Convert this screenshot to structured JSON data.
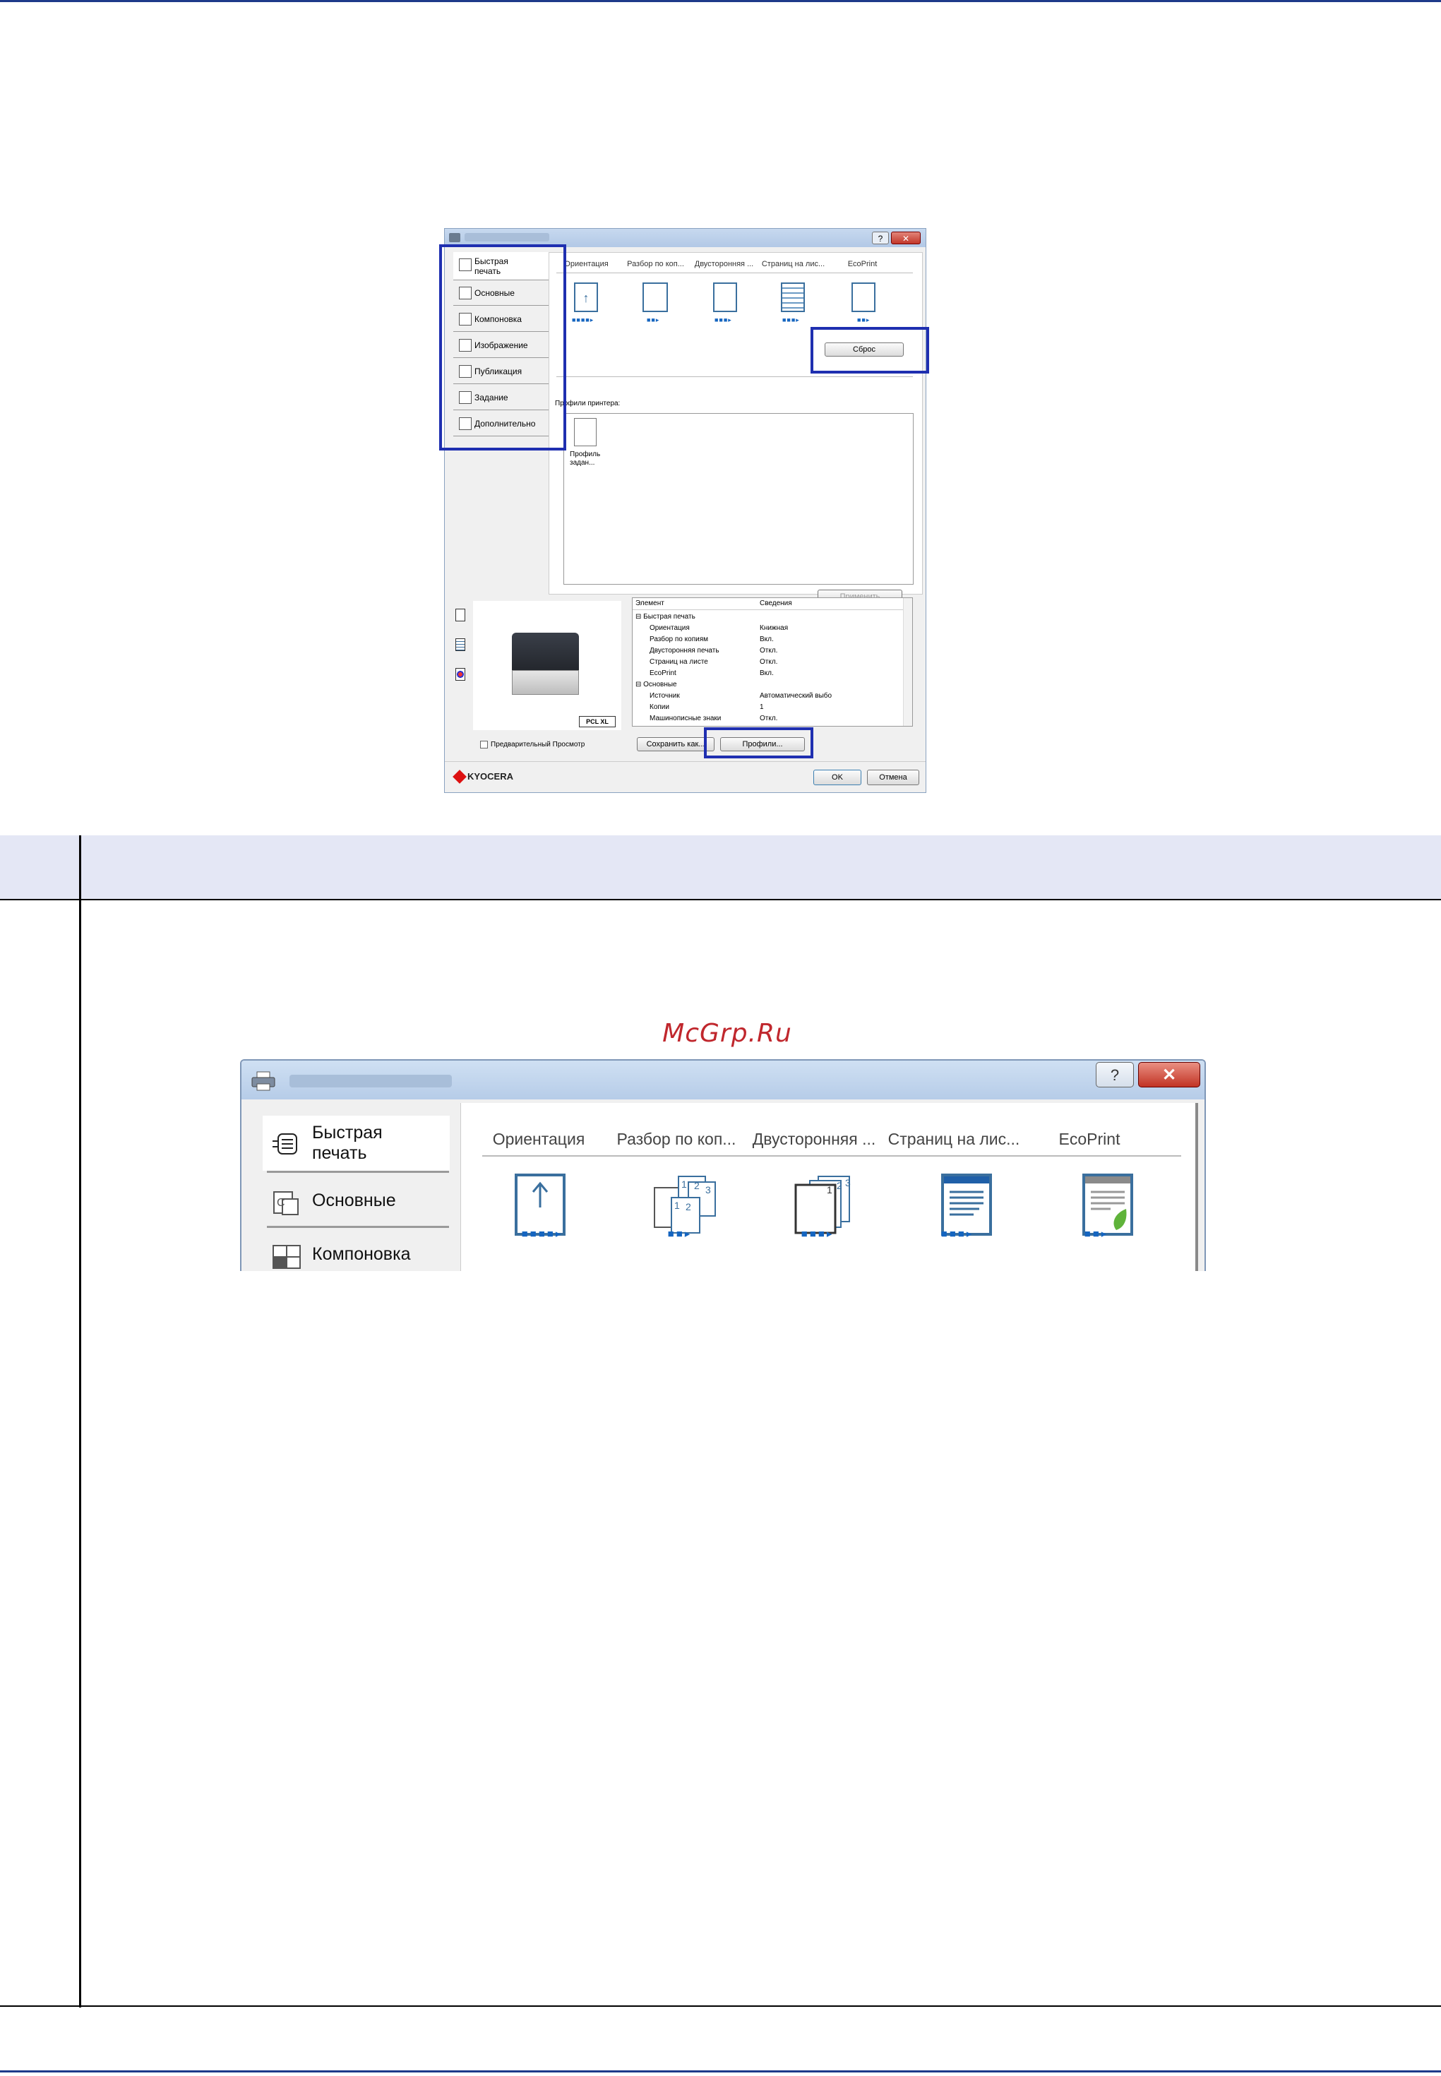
{
  "small_dialog": {
    "nav": [
      "Быстрая печать",
      "Основные",
      "Компоновка",
      "Изображение",
      "Публикация",
      "Задание",
      "Дополнительно"
    ],
    "tabs": [
      "Ориентация",
      "Разбор по коп...",
      "Двусторонняя ...",
      "Страниц на лис...",
      "EcoPrint"
    ],
    "reset_button": "Сброс",
    "profiles_label": "Профили принтера:",
    "profile_item": "Профиль задан...",
    "apply_button": "Применить",
    "printer_badge": "PCL XL",
    "list_headers": [
      "Элемент",
      "Сведения"
    ],
    "list_rows": [
      {
        "item": "⊟ Быстрая печать",
        "value": ""
      },
      {
        "item": "Ориентация",
        "value": "Книжная"
      },
      {
        "item": "Разбор по копиям",
        "value": "Вкл."
      },
      {
        "item": "Двусторонняя печать",
        "value": "Откл."
      },
      {
        "item": "Страниц на листе",
        "value": "Откл."
      },
      {
        "item": "EcoPrint",
        "value": "Вкл."
      },
      {
        "item": "⊟ Основные",
        "value": ""
      },
      {
        "item": "Источник",
        "value": "Автоматический выбо"
      },
      {
        "item": "Копии",
        "value": "1"
      },
      {
        "item": "Машинописные знаки",
        "value": "Откл."
      }
    ],
    "preview_checkbox": "Предварительный Просмотр",
    "save_as_button": "Сохранить как...",
    "profiles_button": "Профили...",
    "brand": "KYOCERA",
    "ok_button": "OK",
    "cancel_button": "Отмена"
  },
  "watermark": "McGrp.Ru",
  "large_dialog": {
    "help_button": "?",
    "close_button": "✕",
    "nav": [
      "Быстрая печать",
      "Основные",
      "Компоновка"
    ],
    "tabs": [
      "Ориентация",
      "Разбор по коп...",
      "Двусторонняя ...",
      "Страниц на лис...",
      "EcoPrint"
    ],
    "dots": [
      "■■■■▸",
      "■■▸",
      "■■■▸",
      "■■■▸",
      "■■▸"
    ]
  },
  "colors": {
    "highlight": "#1f2fb0",
    "table_header": "#e4e7f5",
    "icon_blue": "#3a6f9e",
    "watermark": "#c0272d"
  }
}
